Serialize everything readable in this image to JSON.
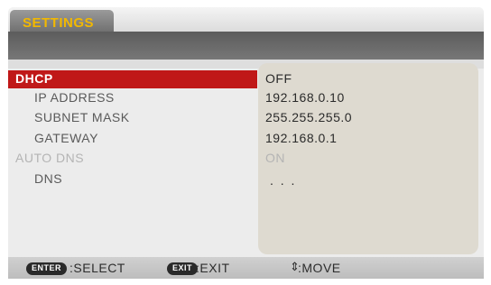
{
  "tab": {
    "label": "SETTINGS"
  },
  "rows": [
    {
      "label": "DHCP",
      "value": "OFF"
    },
    {
      "label": "IP ADDRESS",
      "value": "192.168.0.10"
    },
    {
      "label": "SUBNET MASK",
      "value": "255.255.255.0"
    },
    {
      "label": "GATEWAY",
      "value": "192.168.0.1"
    },
    {
      "label": "AUTO DNS",
      "value": "ON"
    },
    {
      "label": "DNS",
      "value": ". . ."
    }
  ],
  "footer": {
    "enter_key": "ENTER",
    "enter_action": ":SELECT",
    "exit_key": "EXIT",
    "exit_action": ":EXIT",
    "move_icon": "⇕",
    "move_action": ":MOVE"
  },
  "colors": {
    "tab_text": "#f2b800",
    "selection": "#c01818",
    "panel": "#dedad0"
  }
}
